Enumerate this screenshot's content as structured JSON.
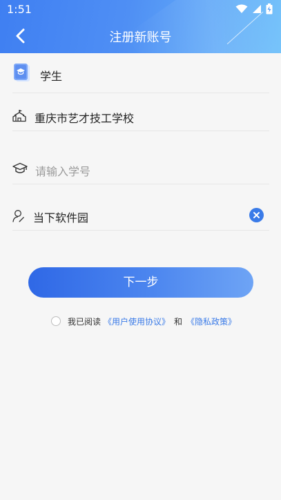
{
  "status_bar": {
    "time": "1:51"
  },
  "nav": {
    "title": "注册新账号"
  },
  "form": {
    "role": "学生",
    "school": "重庆市艺才技工学校",
    "student_id_placeholder": "请输入学号",
    "name": "当下软件园"
  },
  "actions": {
    "next_label": "下一步"
  },
  "agreement": {
    "prefix": "我已阅读",
    "user_agreement": "《用户使用协议》",
    "and": "和",
    "privacy_policy": "《隐私政策》"
  },
  "colors": {
    "accent": "#3a7be8",
    "header_start": "#3f7ff2",
    "header_end": "#77c4fa",
    "background": "#f6f6f6"
  },
  "icons": {
    "role": "student-card-icon",
    "school": "school-building-icon",
    "student_id": "graduation-cap-icon",
    "name": "person-edit-icon",
    "clear": "clear-circle-icon"
  }
}
